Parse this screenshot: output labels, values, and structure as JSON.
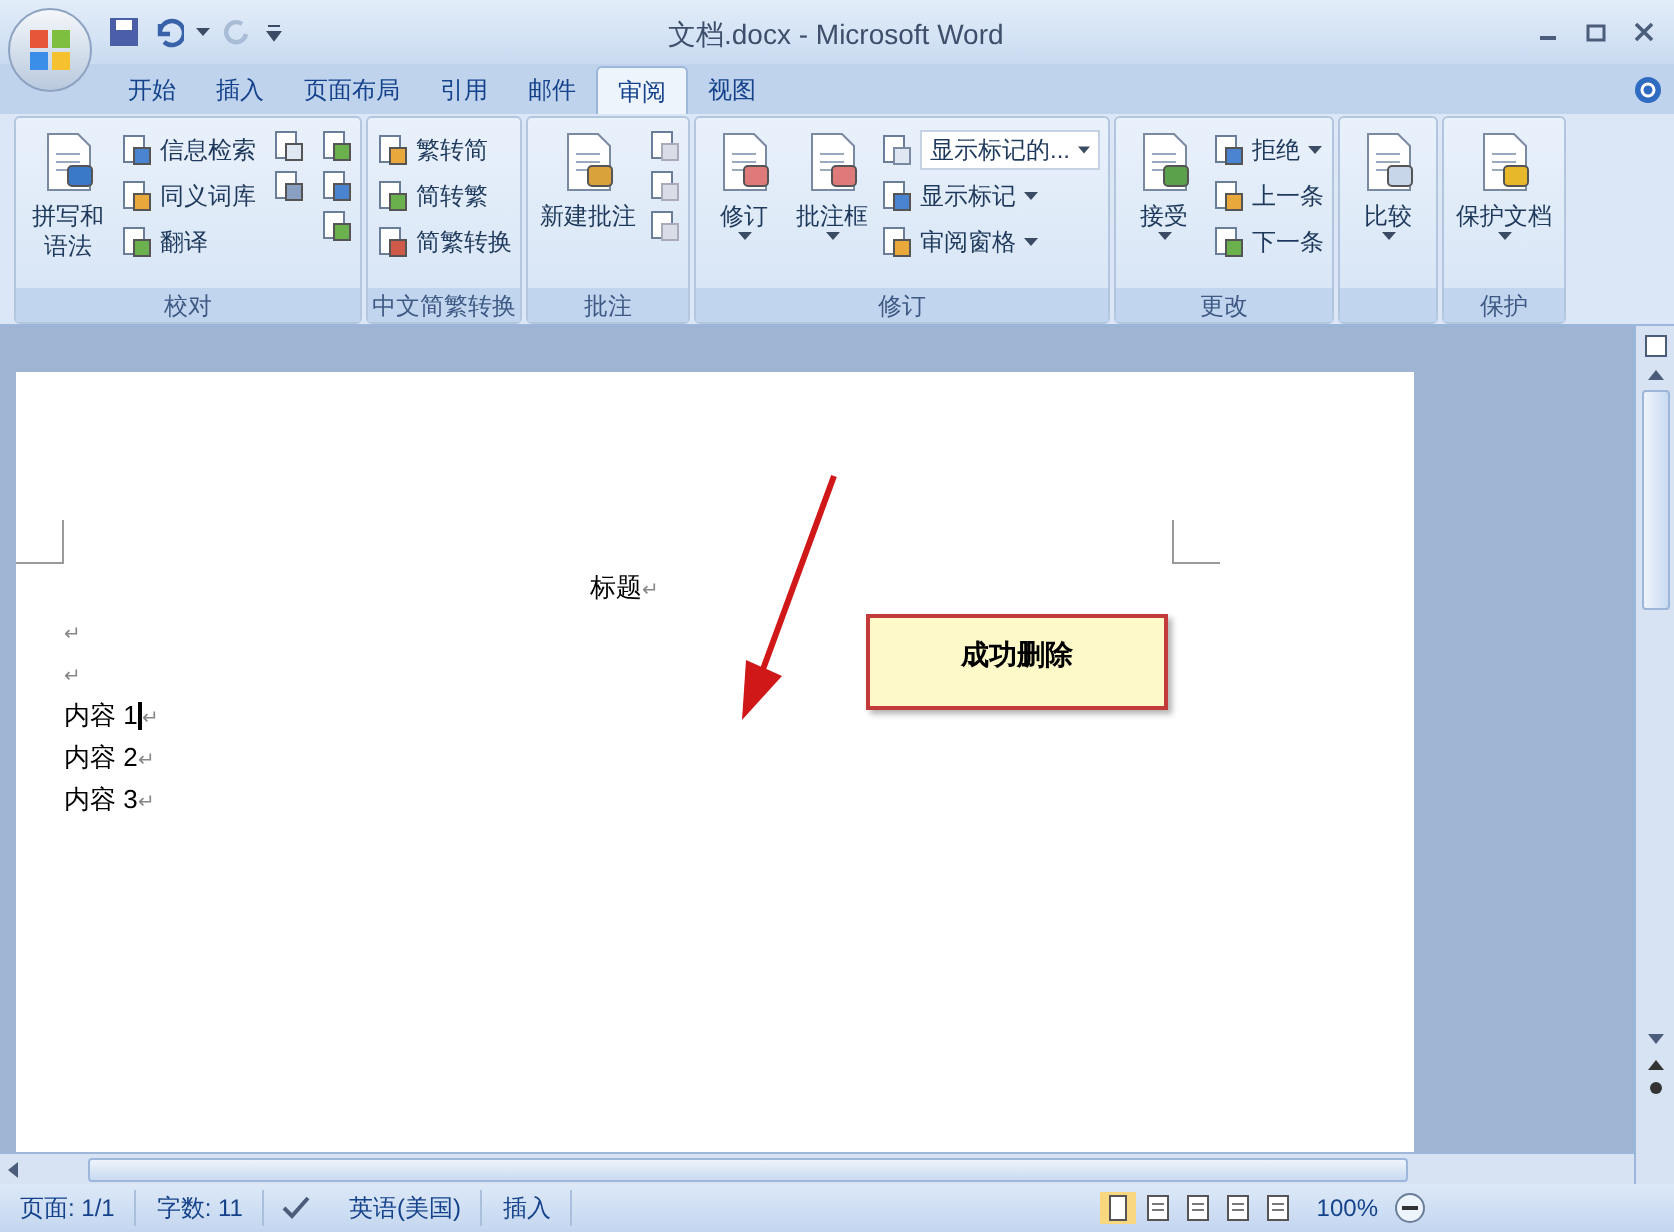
{
  "window": {
    "title": "文档.docx - Microsoft Word"
  },
  "tabs": [
    {
      "label": "开始",
      "selected": false
    },
    {
      "label": "插入",
      "selected": false
    },
    {
      "label": "页面布局",
      "selected": false
    },
    {
      "label": "引用",
      "selected": false
    },
    {
      "label": "邮件",
      "selected": false
    },
    {
      "label": "审阅",
      "selected": true
    },
    {
      "label": "视图",
      "selected": false
    }
  ],
  "ribbon_groups": [
    {
      "label": "校对",
      "items": [
        {
          "kind": "large",
          "label": "拼写和语法",
          "dropdown": false
        },
        {
          "kind": "small",
          "label": "信息检索",
          "dropdown": false
        },
        {
          "kind": "small",
          "label": "同义词库",
          "dropdown": false
        },
        {
          "kind": "small",
          "label": "翻译",
          "dropdown": false
        }
      ]
    },
    {
      "label": "中文简繁转换",
      "items": [
        {
          "kind": "small",
          "label": "繁转简",
          "dropdown": false
        },
        {
          "kind": "small",
          "label": "简转繁",
          "dropdown": false
        },
        {
          "kind": "small",
          "label": "简繁转换",
          "dropdown": false
        }
      ]
    },
    {
      "label": "批注",
      "items": [
        {
          "kind": "large",
          "label": "新建批注",
          "dropdown": false
        }
      ]
    },
    {
      "label": "修订",
      "items": [
        {
          "kind": "large",
          "label": "修订",
          "dropdown": true
        },
        {
          "kind": "large",
          "label": "批注框",
          "dropdown": true
        },
        {
          "kind": "combo",
          "label": "显示标记的...",
          "dropdown": true
        },
        {
          "kind": "small",
          "label": "显示标记",
          "dropdown": true
        },
        {
          "kind": "small",
          "label": "审阅窗格",
          "dropdown": true
        }
      ]
    },
    {
      "label": "更改",
      "items": [
        {
          "kind": "large",
          "label": "接受",
          "dropdown": true
        },
        {
          "kind": "small",
          "label": "拒绝",
          "dropdown": true
        },
        {
          "kind": "small",
          "label": "上一条",
          "dropdown": false
        },
        {
          "kind": "small",
          "label": "下一条",
          "dropdown": false
        }
      ]
    },
    {
      "items": [
        {
          "kind": "large",
          "label": "比较",
          "dropdown": true
        }
      ]
    },
    {
      "label": "保护",
      "items": [
        {
          "kind": "large",
          "label": "保护文档",
          "dropdown": true
        }
      ]
    }
  ],
  "document": {
    "heading": "标题",
    "lines": [
      {
        "cursor": false
      },
      {
        "cursor": false
      },
      {
        "text": "内容 1",
        "cursor": true
      },
      {
        "text": "内容 2",
        "cursor": false
      },
      {
        "text": "内容 3",
        "cursor": false
      }
    ],
    "paragraph_mark": "↵"
  },
  "annotation": {
    "text": "成功删除"
  },
  "status_bar": {
    "items": [
      "页面: 1/1",
      "字数: 11",
      "英语(美国)",
      "插入"
    ],
    "zoom": "100%"
  }
}
